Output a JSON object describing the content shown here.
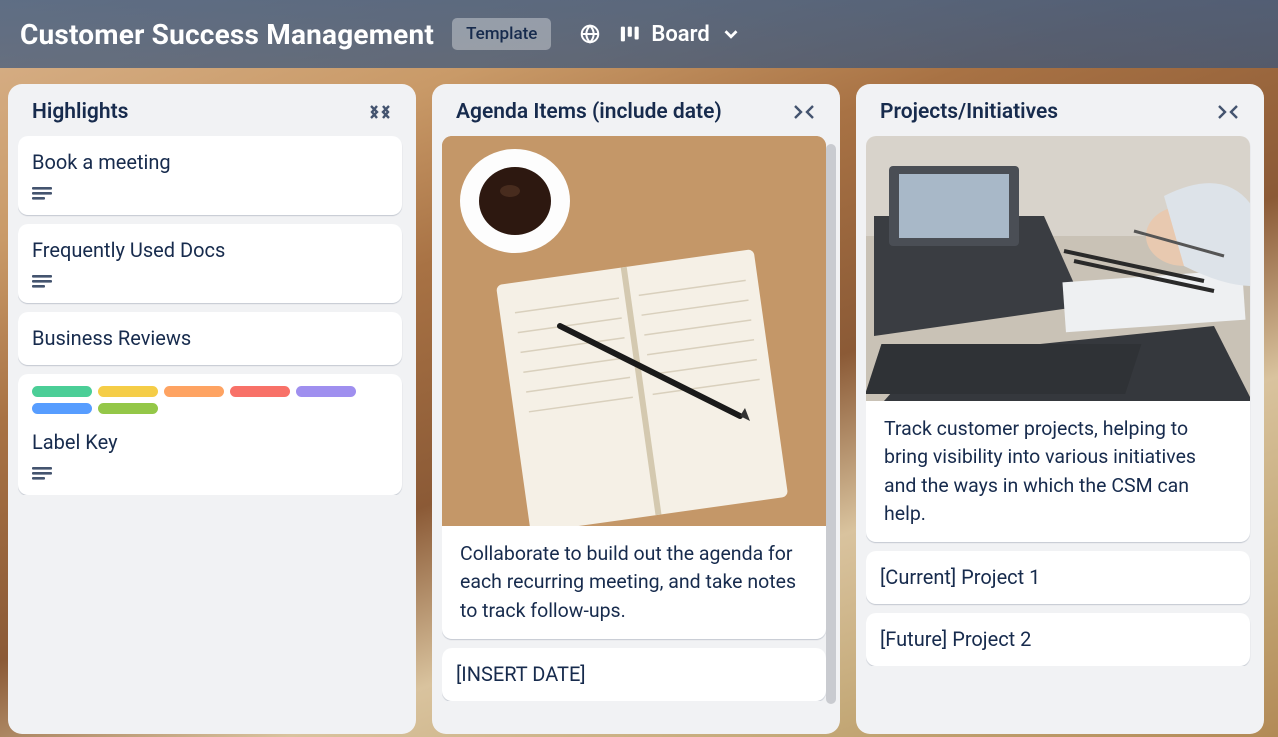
{
  "header": {
    "title": "Customer Success Management",
    "template_label": "Template",
    "view_label": "Board"
  },
  "lists": [
    {
      "title": "Highlights",
      "cards": [
        {
          "title": "Book a meeting",
          "has_desc": true
        },
        {
          "title": "Frequently Used Docs",
          "has_desc": true
        },
        {
          "title": "Business Reviews"
        },
        {
          "title": "Label Key",
          "has_desc": true,
          "labels": [
            "#4bce97",
            "#f5cd47",
            "#fea362",
            "#f87168",
            "#9f8fef",
            "#579dff",
            "#94c748"
          ]
        }
      ]
    },
    {
      "title": "Agenda Items (include date)",
      "cards": [
        {
          "cover": "notebook",
          "title": "Collaborate to build out the agenda for each recurring meeting, and take notes to track follow-ups."
        },
        {
          "title": "[INSERT DATE]"
        }
      ]
    },
    {
      "title": "Projects/Initiatives",
      "cards": [
        {
          "cover": "meeting",
          "title": "Track customer projects, helping to bring visibility into various initiatives and the ways in which the CSM can help."
        },
        {
          "title": "[Current] Project 1"
        },
        {
          "title": "[Future] Project 2"
        }
      ]
    }
  ]
}
